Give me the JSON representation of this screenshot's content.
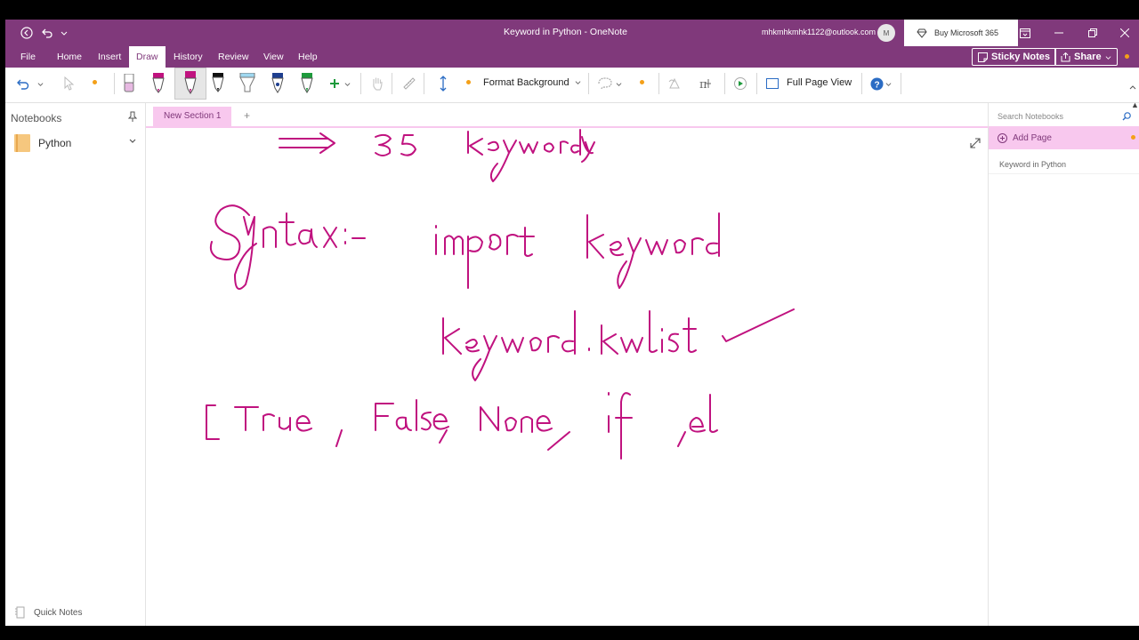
{
  "window": {
    "title": "Keyword in Python",
    "app_name": "OneNote",
    "title_separator": "-",
    "account_email": "mhkmhkmhk1122@outlook.com",
    "avatar_initial": "M",
    "buy_label": "Buy Microsoft 365"
  },
  "menu": {
    "items": [
      "File",
      "Home",
      "Insert",
      "Draw",
      "History",
      "Review",
      "View",
      "Help"
    ],
    "active": "Draw",
    "sticky_notes": "Sticky Notes",
    "share": "Share"
  },
  "ribbon": {
    "format_background": "Format Background",
    "full_page_view": "Full Page View"
  },
  "notebooks": {
    "header": "Notebooks",
    "items": [
      {
        "name": "Python"
      }
    ],
    "quick_notes": "Quick Notes"
  },
  "sections": {
    "tabs": [
      "New Section 1"
    ],
    "add_label": "+"
  },
  "pages": {
    "search_placeholder": "Search Notebooks",
    "add_page": "Add Page",
    "items": [
      "Keyword in Python"
    ]
  },
  "ink": {
    "color": "#c0127f",
    "line1": "⟹ 35 Keywords",
    "line2": "Syntax:-   import keyword",
    "line3": "keyword.kwlist ✓",
    "line4": "[True, False, None, if, el"
  },
  "colors": {
    "brand": "#80397b",
    "accent_pink": "#f8c8ee",
    "ink": "#c0127f"
  }
}
